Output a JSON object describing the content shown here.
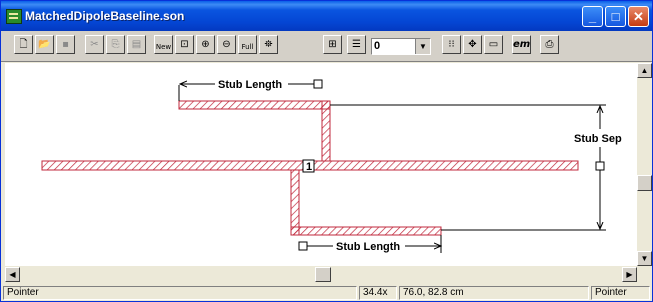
{
  "window": {
    "title": "MatchedDipoleBaseline.son"
  },
  "titlebar": {
    "minimize_glyph": "_",
    "maximize_glyph": "□",
    "close_glyph": "✕"
  },
  "toolbar": {
    "level_value": "0",
    "em_label": "em",
    "new_label": "New",
    "full_label": "Full"
  },
  "canvas": {
    "stub_length_top_label": "Stub Length",
    "stub_length_bottom_label": "Stub Length",
    "stub_sep_label": "Stub Sep",
    "port_label": "1",
    "hatch_color": "#c0283c"
  },
  "statusbar": {
    "mode_left": "Pointer",
    "zoom": "34.4x",
    "coords": "76.0, 82.8 cm",
    "mode_right": "Pointer"
  }
}
